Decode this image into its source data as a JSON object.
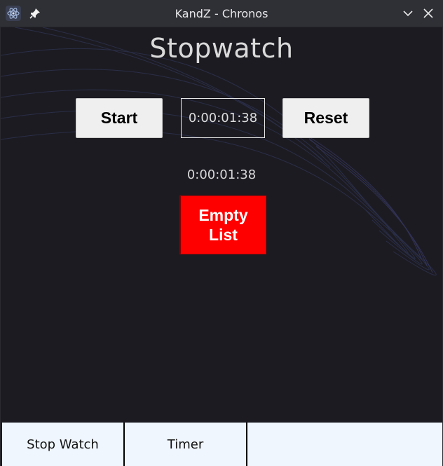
{
  "window": {
    "title": "KandZ - Chronos",
    "icons": {
      "app": "atom-app-icon",
      "pin": "pin-icon",
      "minimize": "chevron-down-icon",
      "close": "close-icon"
    }
  },
  "main": {
    "heading": "Stopwatch",
    "start_label": "Start",
    "time_display": "0:00:01:38",
    "reset_label": "Reset",
    "laps": [
      "0:00:01:38"
    ],
    "empty_list_line1": "Empty",
    "empty_list_line2": "List"
  },
  "nav": {
    "tabs": [
      {
        "label": "Stop Watch"
      },
      {
        "label": "Timer"
      }
    ]
  },
  "colors": {
    "background": "#1c1b22",
    "empty_button": "#ff0000",
    "nav_background": "#eff6fd"
  }
}
